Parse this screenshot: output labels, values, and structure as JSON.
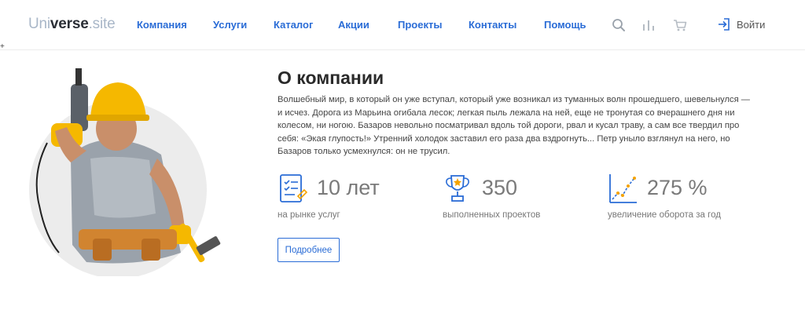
{
  "header": {
    "logo": {
      "part1": "Uni",
      "part2": "verse",
      "part3": ".site"
    },
    "nav": [
      {
        "label": "Компания"
      },
      {
        "label": "Услуги"
      },
      {
        "label": "Каталог"
      },
      {
        "label": "Акции"
      },
      {
        "label": "Проекты"
      },
      {
        "label": "Контакты"
      },
      {
        "label": "Помощь"
      }
    ],
    "icons": [
      "search-icon",
      "compare-icon",
      "cart-icon"
    ],
    "login_label": "Войти"
  },
  "stray_mark": "+",
  "about": {
    "title": "О компании",
    "description": "Волшебный мир, в который он уже вступал, который уже возникал из туманных волн прошедшего, шевельнулся — и исчез. Дорога из Марьина огибала лесок; легкая пыль лежала на ней, еще не тронутая со вчерашнего дня ни колесом, ни ногою. Базаров невольно посматривал вдоль той дороги, рвал и кусал траву, а сам все твердил про себя: «Экая глупость!» Утренний холодок заставил его раза два вздрогнуть... Петр уныло взглянул на него, но Базаров только усмехнулся: он не трусил.",
    "stats": [
      {
        "value": "10 лет",
        "label": "на рынке услуг",
        "icon": "document-checklist-icon"
      },
      {
        "value": "350",
        "label": "выполненных проектов",
        "icon": "trophy-icon"
      },
      {
        "value": "275 %",
        "label": "увеличение оборота за год",
        "icon": "growth-chart-icon"
      }
    ],
    "button_label": "Подробнее"
  },
  "colors": {
    "accent": "#2a6cd6",
    "helmet": "#f5b800",
    "text": "#333333"
  }
}
